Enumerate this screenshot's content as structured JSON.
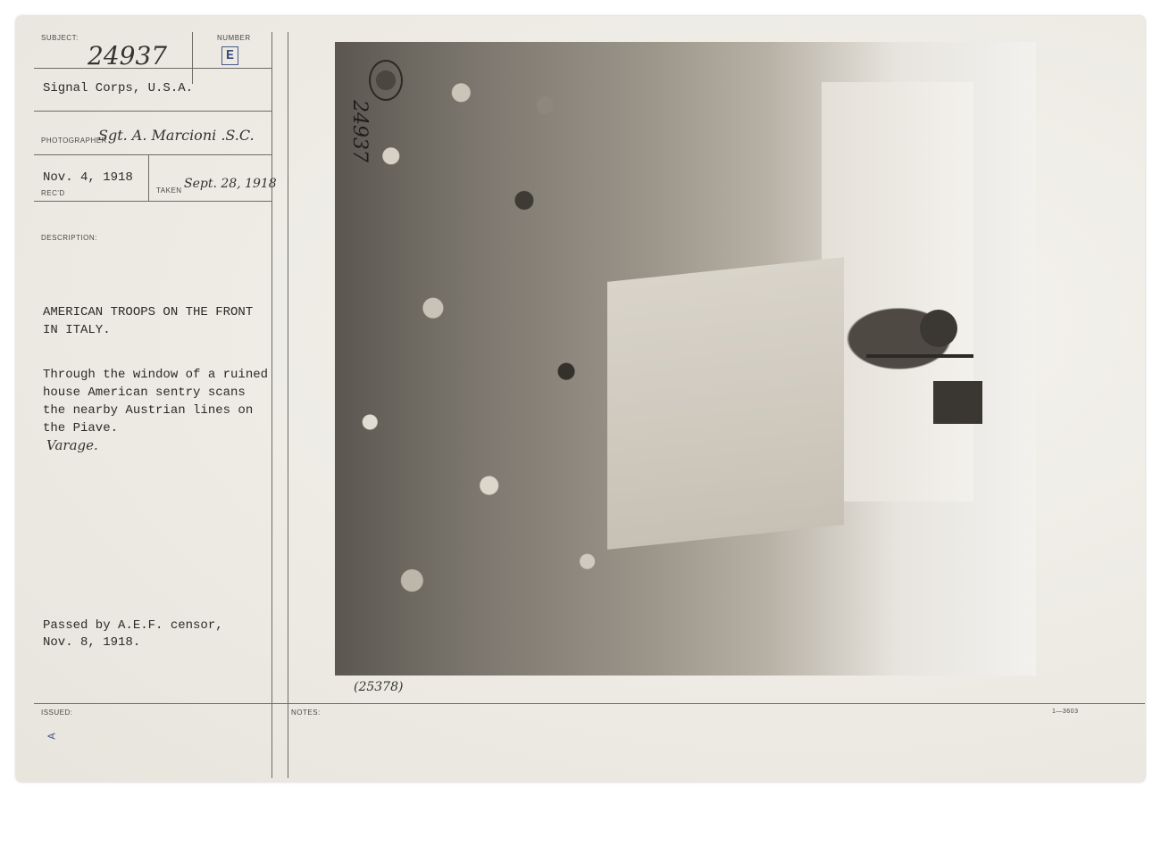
{
  "record": {
    "subject_label": "SUBJECT:",
    "subject_number": "24937",
    "number_label": "NUMBER",
    "number_stamp": "E",
    "agency": "Signal Corps, U.S.A.",
    "photographer_label": "PHOTOGRAPHER",
    "photographer": "Sgt. A. Marcioni .S.C.",
    "received_date": "Nov. 4, 1918",
    "received_label": "REC'D",
    "taken_label": "TAKEN",
    "taken_date": "Sept. 28, 1918",
    "description_label": "DESCRIPTION:",
    "description_title": "AMERICAN TROOPS ON THE FRONT\nIN ITALY.",
    "description_body": "Through the window of a ruined\nhouse American sentry scans\nthe nearby Austrian lines on\nthe Piave.",
    "location_note": "Varage.",
    "censor_note": "Passed by A.E.F. censor,\nNov. 8, 1918.",
    "issued_label": "ISSUED:",
    "issued_mark": "A",
    "notes_label": "NOTES:",
    "form_number": "1—3603"
  },
  "photo": {
    "rotated_number": "24937",
    "caption_number": "(25378)"
  }
}
